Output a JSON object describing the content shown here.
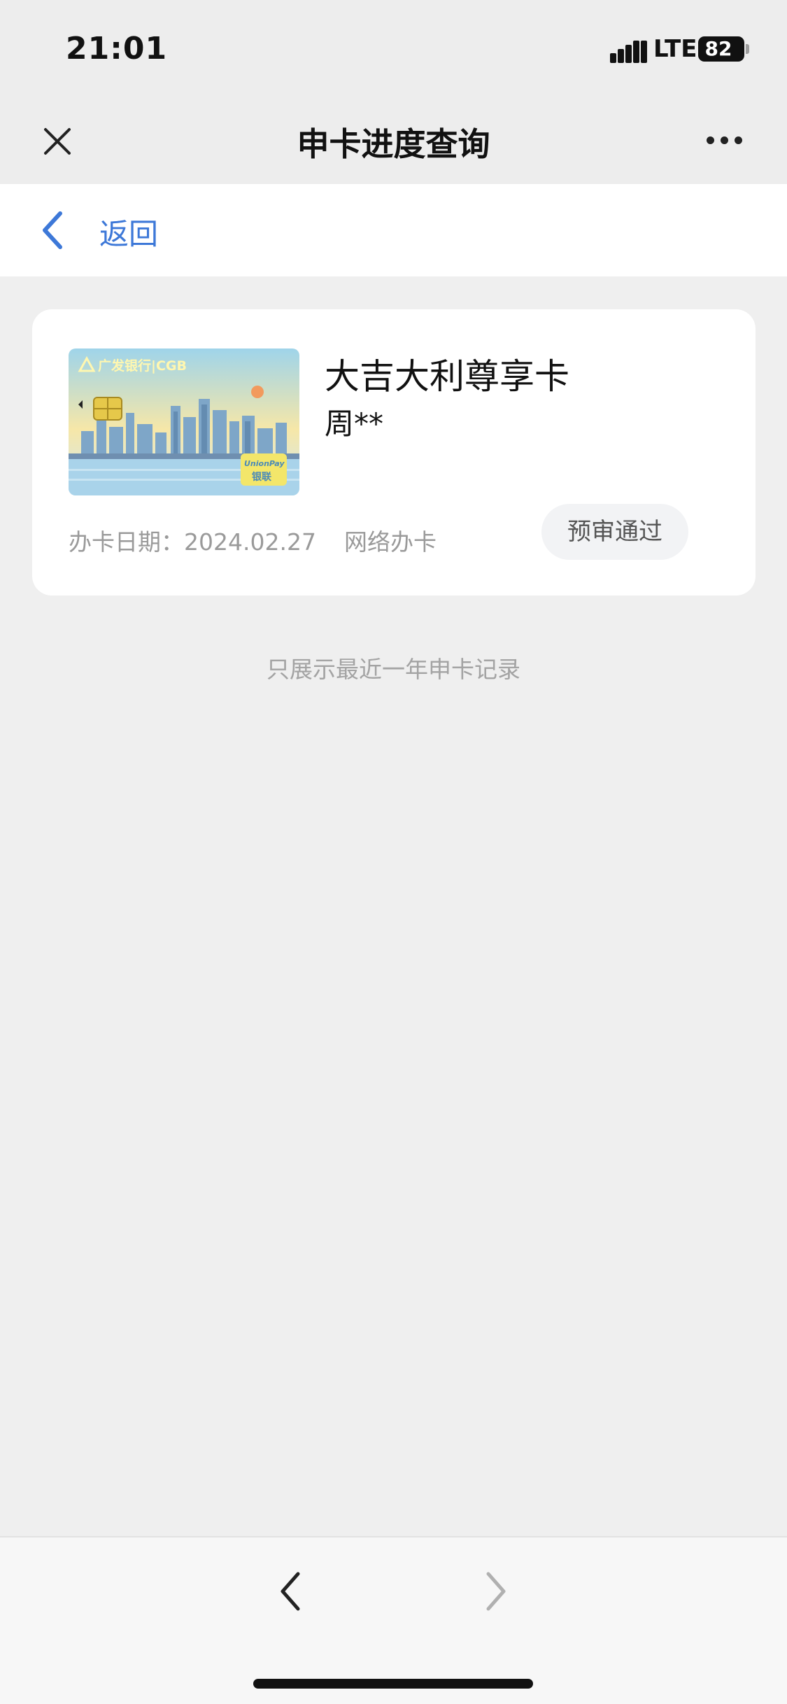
{
  "status_bar": {
    "time": "21:01",
    "network": "LTE",
    "battery_percent": 82,
    "battery_label": "82"
  },
  "header": {
    "title": "申卡进度查询",
    "close_icon": "close-icon",
    "more_icon": "more-icon"
  },
  "back": {
    "label": "返回",
    "icon": "chevron-left-icon"
  },
  "record": {
    "card_name": "大吉大利尊享卡",
    "holder": "周**",
    "date_label": "办卡日期：2024.02.27",
    "channel": "网络办卡",
    "status": "预审通过",
    "card_image": {
      "bank_logo_text": "广发银行|CGB",
      "network_text": "UnionPay 银联"
    }
  },
  "footer_note": "只展示最近一年申卡记录",
  "bottom_nav": {
    "back_icon": "chevron-left-icon",
    "forward_icon": "chevron-right-icon"
  },
  "colors": {
    "accent": "#3d78d8",
    "background": "#efefef",
    "muted_text": "#9a9a9a"
  }
}
